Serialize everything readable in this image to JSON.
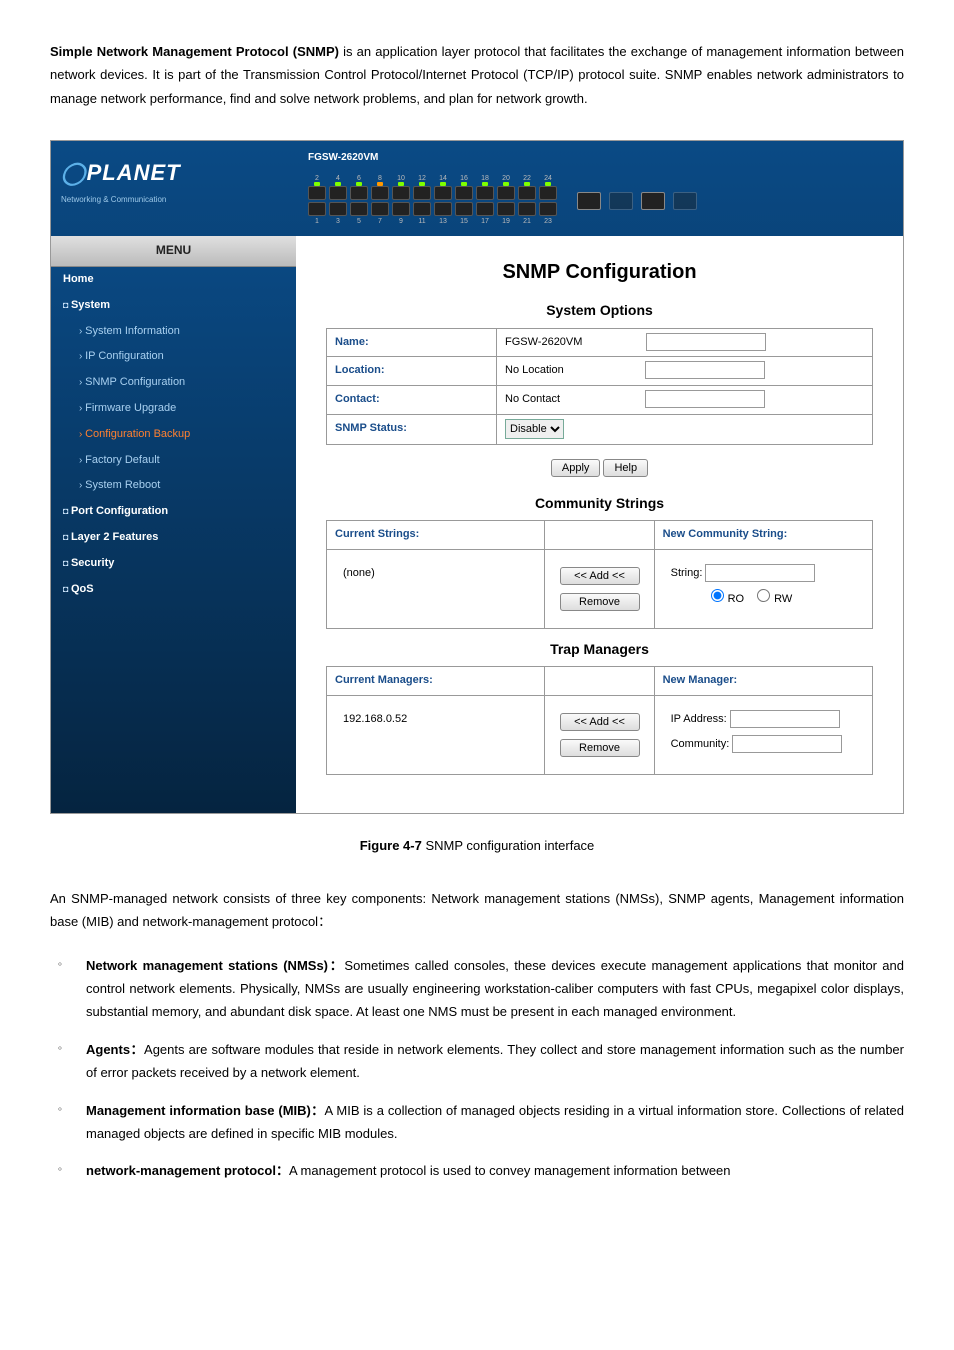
{
  "intro": {
    "heading_prefix": "Simple Network Management Protocol (SNMP)",
    "text1": " is an application layer protocol that facilitates the exchange of management information between network devices. It is part of the Transmission Control Protocol/Internet Protocol (TCP/IP) protocol suite. SNMP enables network administrators to manage network performance, find and solve network problems, and plan for network growth."
  },
  "ui": {
    "model": "FGSW-2620VM",
    "logo": "PLANET",
    "logo_sub": "Networking & Communication",
    "menu_header": "MENU",
    "menu": {
      "home": "Home",
      "system": "System",
      "system_info": "System Information",
      "ip_config": "IP Configuration",
      "snmp_config": "SNMP Configuration",
      "firmware": "Firmware Upgrade",
      "config_backup": "Configuration Backup",
      "factory": "Factory Default",
      "reboot": "System Reboot",
      "port_config": "Port Configuration",
      "layer2": "Layer 2 Features",
      "security": "Security",
      "qos": "QoS"
    },
    "page_title": "SNMP Configuration",
    "system_options": {
      "title": "System Options",
      "name_label": "Name:",
      "name_value": "FGSW-2620VM",
      "location_label": "Location:",
      "location_value": "No Location",
      "contact_label": "Contact:",
      "contact_value": "No Contact",
      "snmp_status_label": "SNMP Status:",
      "snmp_status_value": "Disable",
      "apply": "Apply",
      "help": "Help"
    },
    "community": {
      "title": "Community Strings",
      "current_label": "Current Strings:",
      "current_value": "(none)",
      "new_label": "New Community String:",
      "add": "<< Add <<",
      "remove": "Remove",
      "string_label": "String:",
      "ro": "RO",
      "rw": "RW"
    },
    "trap": {
      "title": "Trap Managers",
      "current_label": "Current Managers:",
      "current_value": "192.168.0.52",
      "new_label": "New Manager:",
      "add": "<< Add <<",
      "remove": "Remove",
      "ip_label": "IP Address:",
      "comm_label": "Community:"
    }
  },
  "figure_caption_prefix": "Figure 4-7",
  "figure_caption_text": " SNMP configuration interface",
  "post": {
    "para1": "An SNMP-managed network consists of three key components: Network management stations (NMSs), SNMP agents, Management information base (MIB) and network-management protocol：",
    "b1_term": "Network management stations (NMSs)",
    "b1_colon": "：",
    "b1_text": "Sometimes called consoles, these devices execute management applications that monitor and control network elements. Physically, NMSs are usually engineering workstation-caliber computers with fast CPUs, megapixel color displays, substantial memory, and abundant disk space. At least one NMS must be present in each managed environment.",
    "b2_term": "Agents",
    "b2_colon": "：",
    "b2_text": "Agents are software modules that reside in network elements. They collect and store management information such as the number of error packets received by a network element.",
    "b3_term": "Management information base (MIB)",
    "b3_colon": "：",
    "b3_text": "A MIB is a collection of managed objects residing in a virtual information store. Collections of related managed objects are defined in specific MIB modules.",
    "b4_term": "network-management protocol",
    "b4_colon": "：",
    "b4_text": "A management protocol is used to convey management information between"
  }
}
